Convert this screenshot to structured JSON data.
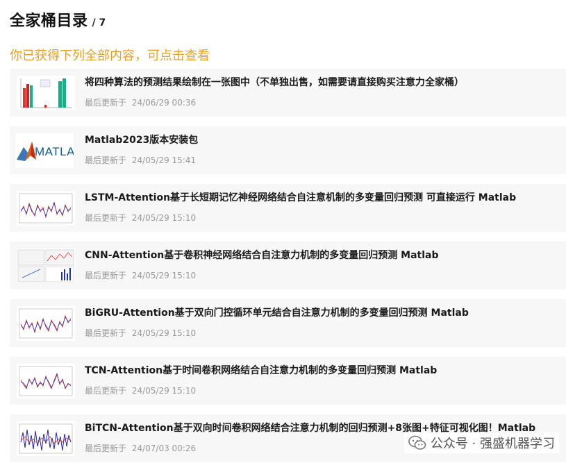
{
  "header": {
    "title": "全家桶目录",
    "count": "/ 7"
  },
  "note": "你已获得下列全部内容，可点击查看",
  "meta_prefix": "最后更新于",
  "items": [
    {
      "title": "将四种算法的预测结果绘制在一张图中（不单独出售，如需要请直接购买注意力全家桶）",
      "updated": "24/06/29 00:36",
      "thumb": "bar-chart-thumbnail"
    },
    {
      "title": "Matlab2023版本安装包",
      "updated": "24/05/29 15:41",
      "thumb": "matlab-logo"
    },
    {
      "title": "LSTM-Attention基于长短期记忆神经网络结合自注意机制的多变量回归预测 可直接运行 Matlab",
      "updated": "24/05/29 15:10",
      "thumb": "line-plot-thumbnail"
    },
    {
      "title": "CNN-Attention基于卷积神经网络结合自注意力机制的多变量回归预测 Matlab",
      "updated": "24/05/29 15:10",
      "thumb": "multi-plot-thumbnail"
    },
    {
      "title": "BiGRU-Attention基于双向门控循环单元结合自注意力机制的多变量回归预测 Matlab",
      "updated": "24/05/29 15:10",
      "thumb": "line-plot-thumbnail"
    },
    {
      "title": "TCN-Attention基于时间卷积网络结合自注意力机制的多变量回归预测 Matlab",
      "updated": "24/05/29 15:10",
      "thumb": "line-plot-thumbnail"
    },
    {
      "title": "BiTCN-Attention基于双向时间卷积网络结合注意力机制的回归预测+8张图+特征可视化图！Matlab",
      "updated": "24/07/03 00:26",
      "thumb": "bar-line-thumbnail"
    }
  ],
  "watermark": {
    "text": "公众号 · 强盛机器学习",
    "icon": "wechat-icon"
  },
  "colors": {
    "accent": "#f0a020",
    "item_bg": "#f7f7f7",
    "meta": "#999999"
  },
  "matlab_logo_text": "MATLAB"
}
